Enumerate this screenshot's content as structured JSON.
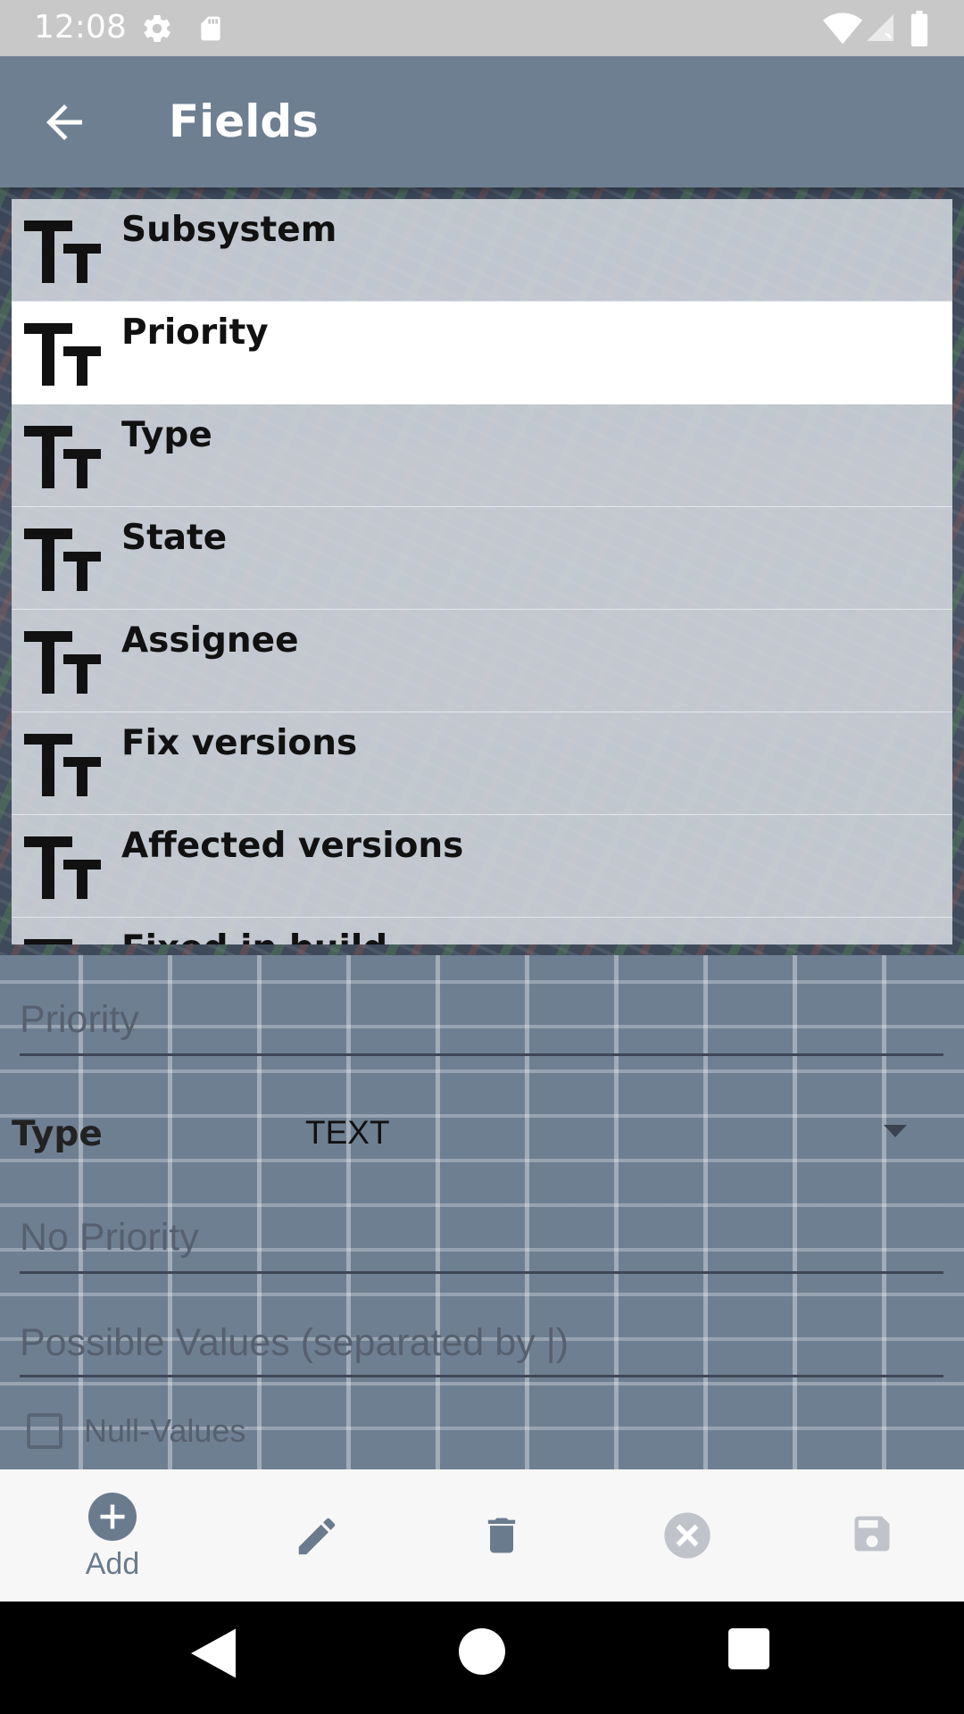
{
  "status_bar": {
    "time": "12:08",
    "left_icons": [
      "gear-icon",
      "sd-card-icon"
    ],
    "right_icons": [
      "wifi-icon",
      "cellular-signal-icon",
      "battery-icon"
    ]
  },
  "app_bar": {
    "title": "Fields",
    "back_icon": "arrow-back-icon"
  },
  "fields": {
    "items": [
      {
        "label": "Subsystem",
        "icon": "text-fields-icon",
        "selected": false
      },
      {
        "label": "Priority",
        "icon": "text-fields-icon",
        "selected": true
      },
      {
        "label": "Type",
        "icon": "text-fields-icon",
        "selected": false
      },
      {
        "label": "State",
        "icon": "text-fields-icon",
        "selected": false
      },
      {
        "label": "Assignee",
        "icon": "text-fields-icon",
        "selected": false
      },
      {
        "label": "Fix versions",
        "icon": "text-fields-icon",
        "selected": false
      },
      {
        "label": "Affected versions",
        "icon": "text-fields-icon",
        "selected": false
      },
      {
        "label": "Fixed in build",
        "icon": "text-fields-icon",
        "selected": false
      }
    ]
  },
  "form": {
    "name_placeholder": "Priority",
    "type_label": "Type",
    "type_value": "TEXT",
    "default_placeholder": "No Priority",
    "possible_values_placeholder": "Possible Values (separated by |)",
    "null_values_label": "Null-Values",
    "null_values_checked": false
  },
  "toolbar": {
    "add_label": "Add",
    "icons": [
      "add-circle-icon",
      "edit-icon",
      "delete-icon",
      "cancel-icon",
      "save-icon"
    ]
  },
  "colors": {
    "app_bar": "#6f7f92",
    "selected_row": "#ffffff",
    "toolbar_icon": "#6b7b8e"
  }
}
